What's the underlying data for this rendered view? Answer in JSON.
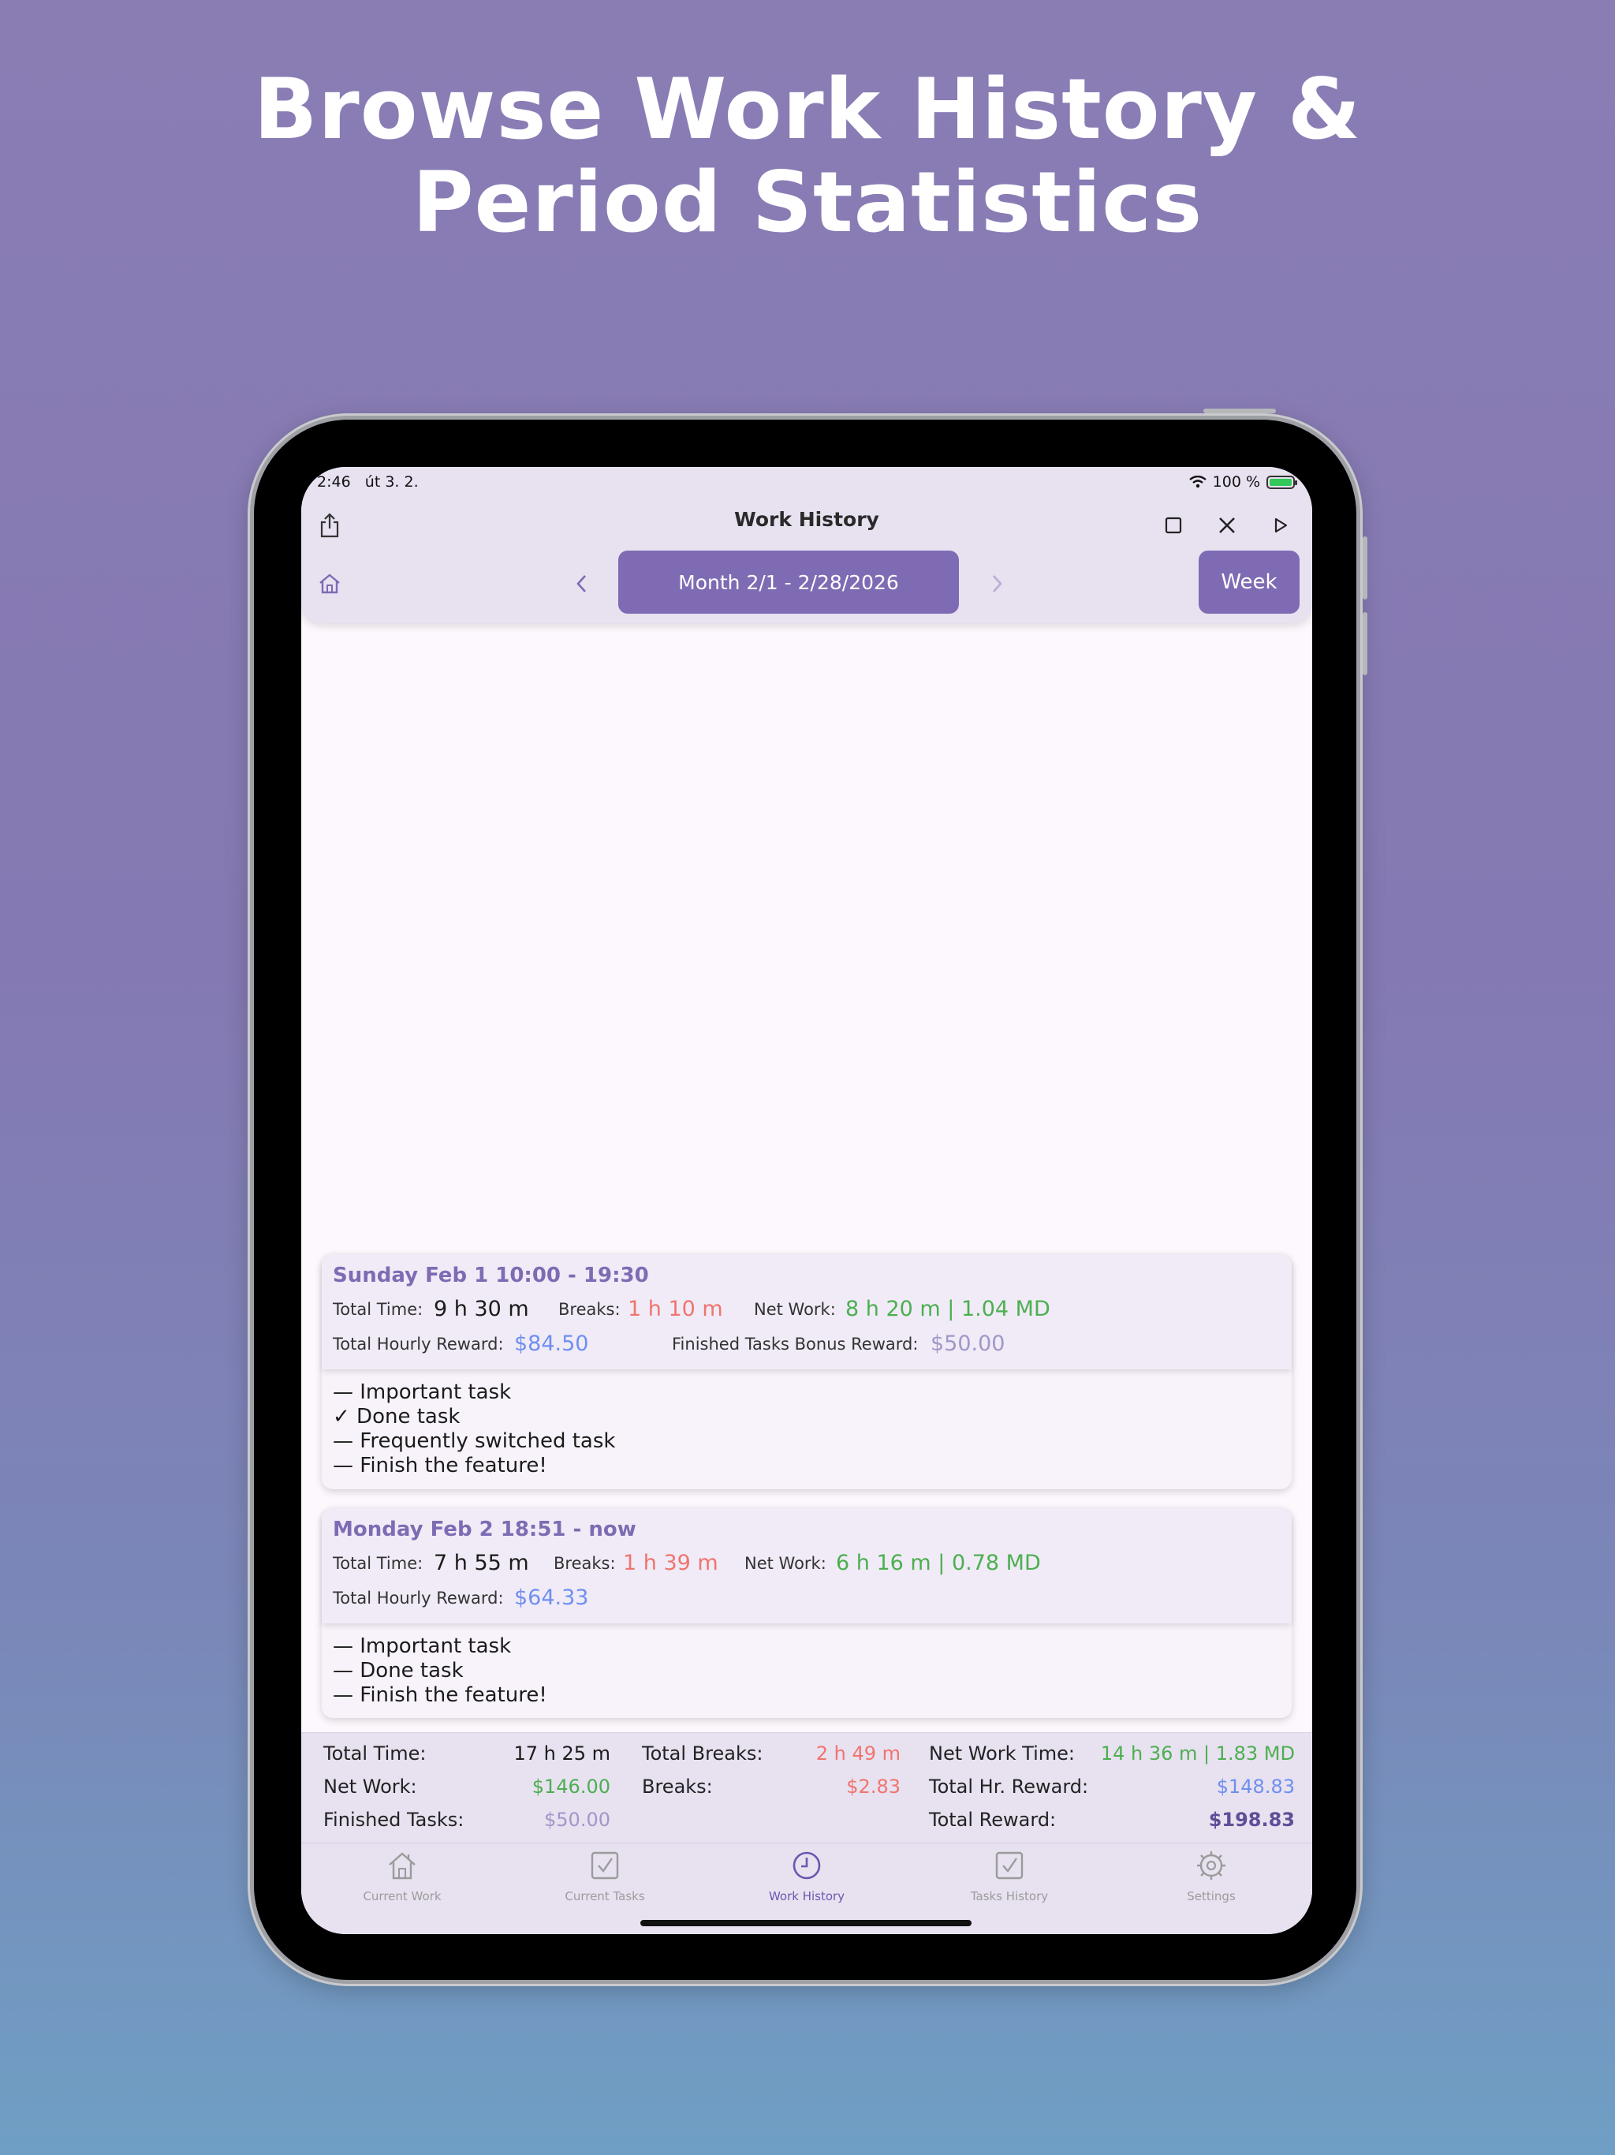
{
  "headline": {
    "line1": "Browse Work History &",
    "line2": "Period Statistics"
  },
  "status_bar": {
    "time": "2:46",
    "date": "út 3. 2.",
    "battery": "100 %"
  },
  "header": {
    "title": "Work History",
    "period_label": "Month 2/1 - 2/28/2026",
    "week_label": "Week"
  },
  "days": [
    {
      "title": "Sunday Feb 1 10:00 - 19:30",
      "total_time_label": "Total Time:",
      "total_time": "9 h 30 m",
      "breaks_label": "Breaks:",
      "breaks": "1 h 10 m",
      "net_work_label": "Net Work:",
      "net_work": "8 h 20 m | 1.04 MD",
      "hourly_reward_label": "Total Hourly Reward:",
      "hourly_reward": "$84.50",
      "bonus_label": "Finished Tasks Bonus Reward:",
      "bonus": "$50.00",
      "tasks": [
        "— Important task",
        "✓ Done task",
        "— Frequently switched task",
        "— Finish the feature!"
      ]
    },
    {
      "title": "Monday Feb 2 18:51 - now",
      "total_time_label": "Total Time:",
      "total_time": "7 h 55 m",
      "breaks_label": "Breaks:",
      "breaks": "1 h 39 m",
      "net_work_label": "Net Work:",
      "net_work": "6 h 16 m | 0.78 MD",
      "hourly_reward_label": "Total Hourly Reward:",
      "hourly_reward": "$64.33",
      "tasks": [
        "— Important task",
        "— Done task",
        "— Finish the feature!"
      ]
    }
  ],
  "summary": {
    "total_time_label": "Total Time:",
    "total_time": "17 h 25 m",
    "total_breaks_label": "Total Breaks:",
    "total_breaks": "2 h 49 m",
    "net_work_time_label": "Net Work Time:",
    "net_work_time": "14 h 36 m | 1.83 MD",
    "net_work_label": "Net Work:",
    "net_work": "$146.00",
    "breaks_label": "Breaks:",
    "breaks": "$2.83",
    "total_hr_reward_label": "Total Hr. Reward:",
    "total_hr_reward": "$148.83",
    "finished_tasks_label": "Finished Tasks:",
    "finished_tasks": "$50.00",
    "total_reward_label": "Total Reward:",
    "total_reward": "$198.83"
  },
  "tabs": [
    {
      "label": "Current Work",
      "icon": "house-icon"
    },
    {
      "label": "Current Tasks",
      "icon": "checkbox-icon"
    },
    {
      "label": "Work History",
      "icon": "clock-icon",
      "active": true
    },
    {
      "label": "Tasks History",
      "icon": "checkbox-icon"
    },
    {
      "label": "Settings",
      "icon": "gear-icon"
    }
  ],
  "colors": {
    "accent": "#7e6bb3",
    "break_red": "#f0746e",
    "net_green": "#4caf50",
    "reward_blue": "#6f8ff0",
    "bonus_violet": "#a197c8"
  }
}
